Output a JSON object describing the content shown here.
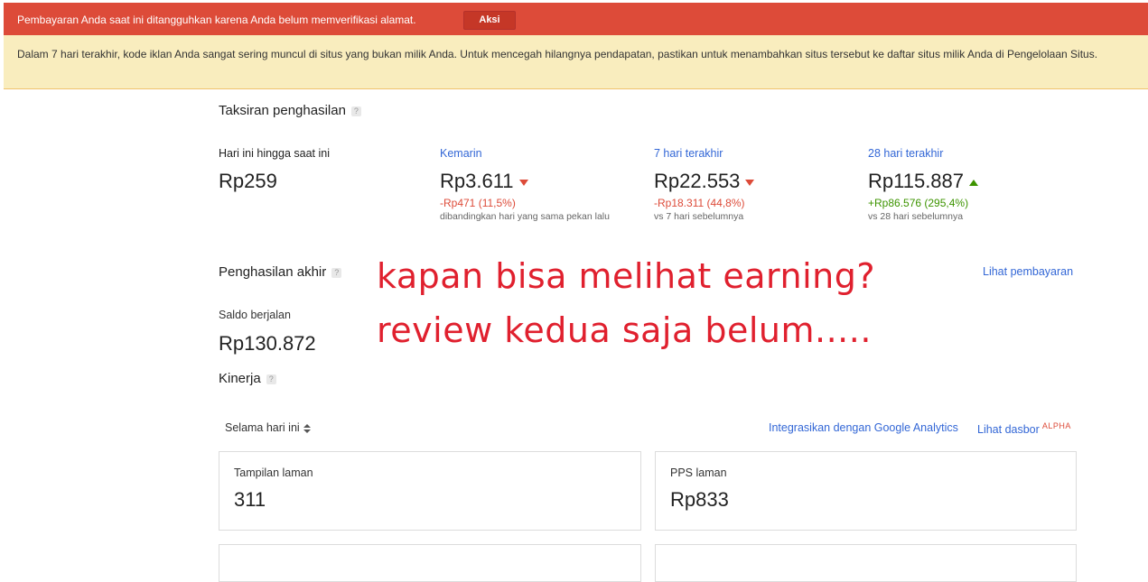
{
  "alert": {
    "message": "Pembayaran Anda saat ini ditangguhkan karena Anda belum memverifikasi alamat.",
    "action_label": "Aksi"
  },
  "warning": {
    "message": "Dalam 7 hari terakhir, kode iklan Anda sangat sering muncul di situs yang bukan milik Anda. Untuk mencegah hilangnya pendapatan, pastikan untuk menambahkan situs tersebut ke daftar situs milik Anda di Pengelolaan Situs."
  },
  "estimated": {
    "title": "Taksiran penghasilan",
    "help": "?",
    "columns": [
      {
        "label": "Hari ini hingga saat ini",
        "value": "Rp259",
        "delta": "",
        "note": ""
      },
      {
        "label": "Kemarin",
        "value": "Rp3.611",
        "delta": "-Rp471 (11,5%)",
        "note": "dibandingkan hari yang sama pekan lalu",
        "trend": "down"
      },
      {
        "label": "7 hari terakhir",
        "value": "Rp22.553",
        "delta": "-Rp18.311 (44,8%)",
        "note": "vs 7 hari sebelumnya",
        "trend": "down"
      },
      {
        "label": "28 hari terakhir",
        "value": "Rp115.887",
        "delta": "+Rp86.576 (295,4%)",
        "note": "vs 28 hari sebelumnya",
        "trend": "up"
      }
    ]
  },
  "final": {
    "title": "Penghasilan akhir",
    "help": "?",
    "view_payments": "Lihat pembayaran",
    "balance_label": "Saldo berjalan",
    "balance_value": "Rp130.872"
  },
  "overlay": {
    "line1": "kapan bisa melihat earning?",
    "line2": "review kedua saja belum....."
  },
  "performance": {
    "title": "Kinerja",
    "help": "?",
    "period": "Selama hari ini",
    "integrate_link": "Integrasikan dengan Google Analytics",
    "dashboard_link": "Lihat dasbor",
    "alpha_badge": "ALPHA",
    "cards": [
      {
        "label": "Tampilan laman",
        "value": "311"
      },
      {
        "label": "PPS laman",
        "value": "Rp833"
      }
    ]
  },
  "colors": {
    "alert_bg": "#dd4b39",
    "warning_bg": "#f9edbe",
    "link": "#3367d6",
    "negative": "#dd4b39",
    "positive": "#3d9400",
    "overlay_text": "#e0202e"
  }
}
